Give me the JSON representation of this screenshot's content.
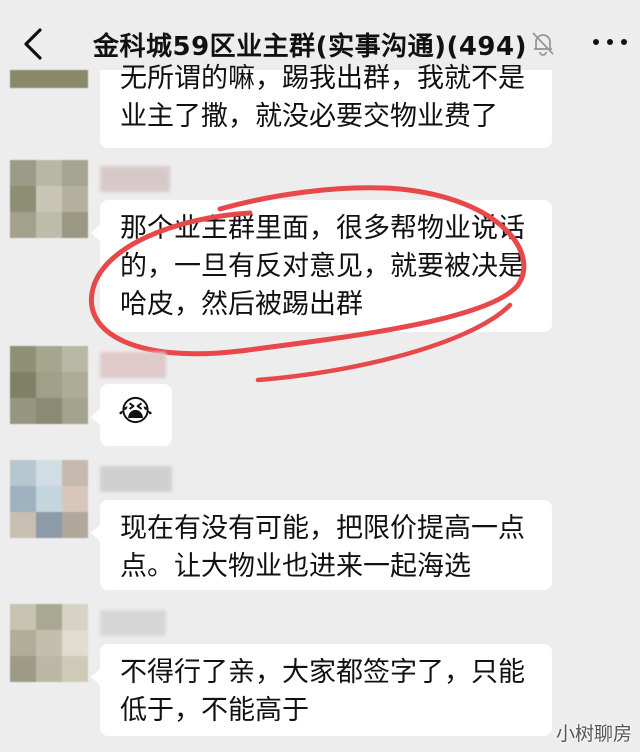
{
  "header": {
    "title": "金科城59区业主群(实事沟通)(494)",
    "back_icon": "chevron-left-icon",
    "mute_icon": "bell-off-icon",
    "more_icon": "more-dots-icon"
  },
  "messages": [
    {
      "lines": [
        "无所谓的嘛，踢我出群，我就不是",
        "业主了撒，就没必要交物业费了"
      ]
    },
    {
      "lines": [
        "那个业主群里面，很多帮物业说话",
        "的，一旦有反对意见，就要被决是",
        "哈皮，然后被踢出群"
      ],
      "highlight_color": "#e8484a"
    },
    {
      "emoji": "😭"
    },
    {
      "lines": [
        "现在有没有可能，把限价提高一点",
        "点。让大物业也进来一起海选"
      ]
    },
    {
      "lines": [
        "不得行了亲，大家都签字了，只能",
        "低于，不能高于"
      ]
    }
  ],
  "watermark": "小树聊房",
  "colors": {
    "background": "#ededed",
    "bubble": "#ffffff",
    "circle": "#e8484a"
  }
}
